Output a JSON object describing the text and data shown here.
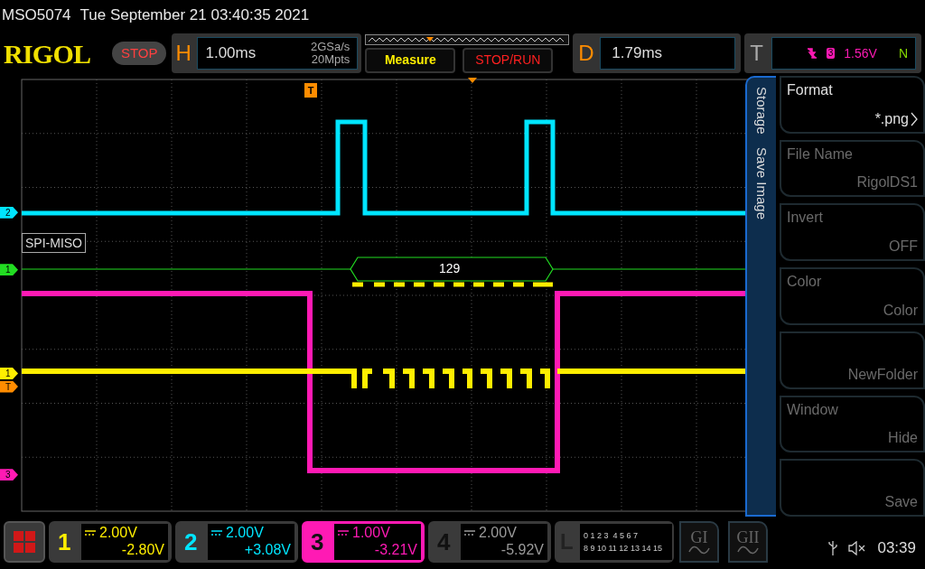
{
  "header": {
    "model": "MSO5074",
    "datetime": "Tue September 21 03:40:35 2021"
  },
  "toolbar": {
    "logo": "RIGOL",
    "run_state": "STOP",
    "horizontal": {
      "letter": "H",
      "scale": "1.00ms",
      "sample_rate": "2GSa/s",
      "memory_depth": "20Mpts"
    },
    "buttons": [
      "Measure",
      "STOP/RUN"
    ],
    "delay": {
      "letter": "D",
      "value": "1.79ms"
    },
    "trigger": {
      "letter": "T",
      "source": "3",
      "level": "1.56V",
      "mode": "N"
    }
  },
  "trigger_marker": "T",
  "markers": [
    {
      "label": "2",
      "color": "#00e5ff"
    },
    {
      "label": "1",
      "color": "#22dd22"
    },
    {
      "label": "1",
      "color": "#ffee00"
    },
    {
      "label": "T",
      "color": "#ff8c00"
    },
    {
      "label": "3",
      "color": "#ff1ab4"
    }
  ],
  "decoder": {
    "label": "SPI-MISO",
    "value": "129"
  },
  "side_menu": {
    "tabs": [
      "Storage",
      "Save Image"
    ],
    "items": [
      {
        "label": "Format",
        "value": "*.png",
        "disabled": false
      },
      {
        "label": "File Name",
        "value": "RigolDS1",
        "disabled": true
      },
      {
        "label": "Invert",
        "value": "OFF",
        "disabled": true
      },
      {
        "label": "Color",
        "value": "Color",
        "disabled": true
      },
      {
        "value": "NewFolder",
        "disabled": true
      },
      {
        "label": "Window",
        "value": "Hide",
        "disabled": true
      },
      {
        "value": "Save",
        "disabled": true
      }
    ]
  },
  "channels": [
    {
      "number": "1",
      "color": "#ffee00",
      "scale": "2.00V",
      "offset": "-2.80V",
      "on": true,
      "selected": false
    },
    {
      "number": "2",
      "color": "#00e5ff",
      "scale": "2.00V",
      "offset": "+3.08V",
      "on": true,
      "selected": false
    },
    {
      "number": "3",
      "color": "#ff1ab4",
      "scale": "1.00V",
      "offset": "-3.21V",
      "on": true,
      "selected": true
    },
    {
      "number": "4",
      "scale": "2.00V",
      "offset": "-5.92V",
      "on": false,
      "selected": false
    }
  ],
  "logic": {
    "letter": "L",
    "row_1": "0 1 2 3  4 5 6 7",
    "row_2": "8 9 10 11 12 13 14 15"
  },
  "generators": [
    "GI",
    "GII"
  ],
  "status": {
    "time": "03:39"
  }
}
